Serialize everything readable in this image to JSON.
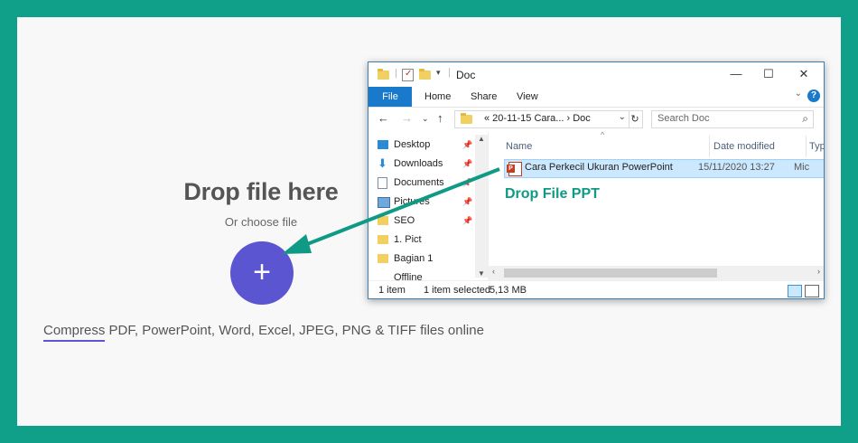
{
  "dropzone": {
    "title": "Drop file here",
    "subtitle": "Or choose file",
    "add_button": "+",
    "tagline_keyword": "Compress",
    "tagline_rest": " PDF, PowerPoint, Word, Excel, JPEG, PNG & TIFF files online"
  },
  "explorer": {
    "title": "Doc",
    "controls": {
      "minimize": "—",
      "maximize": "☐",
      "close": "✕"
    },
    "ribbon_tabs": [
      "File",
      "Home",
      "Share",
      "View"
    ],
    "help": "?",
    "address_path": "«  20-11-15 Cara...  ›  Doc",
    "search_placeholder": "Search Doc",
    "nav_items": [
      {
        "label": "Desktop",
        "icon": "desktop-icon",
        "pinned": true
      },
      {
        "label": "Downloads",
        "icon": "download-icon",
        "pinned": true
      },
      {
        "label": "Documents",
        "icon": "documents-icon",
        "pinned": true
      },
      {
        "label": "Pictures",
        "icon": "pictures-icon",
        "pinned": true
      },
      {
        "label": "SEO",
        "icon": "folder-icon",
        "pinned": true
      },
      {
        "label": "1. Pict",
        "icon": "folder-icon",
        "pinned": false
      },
      {
        "label": "Bagian 1",
        "icon": "folder-icon",
        "pinned": false
      },
      {
        "label": "Offline",
        "icon": "folder-icon",
        "pinned": false
      }
    ],
    "columns": [
      "Name",
      "Date modified",
      "Typ"
    ],
    "files": [
      {
        "name": "Cara Perkecil Ukuran PowerPoint",
        "date": "15/11/2020 13:27",
        "type": "Mic"
      }
    ],
    "annotation": "Drop File PPT",
    "status": {
      "count": "1 item",
      "selected": "1 item selected",
      "size": "5,13 MB"
    }
  },
  "colors": {
    "frame": "#10a08a",
    "accent": "#5b55d1",
    "annotation": "#0f9a85",
    "file_tab": "#1979ca"
  }
}
